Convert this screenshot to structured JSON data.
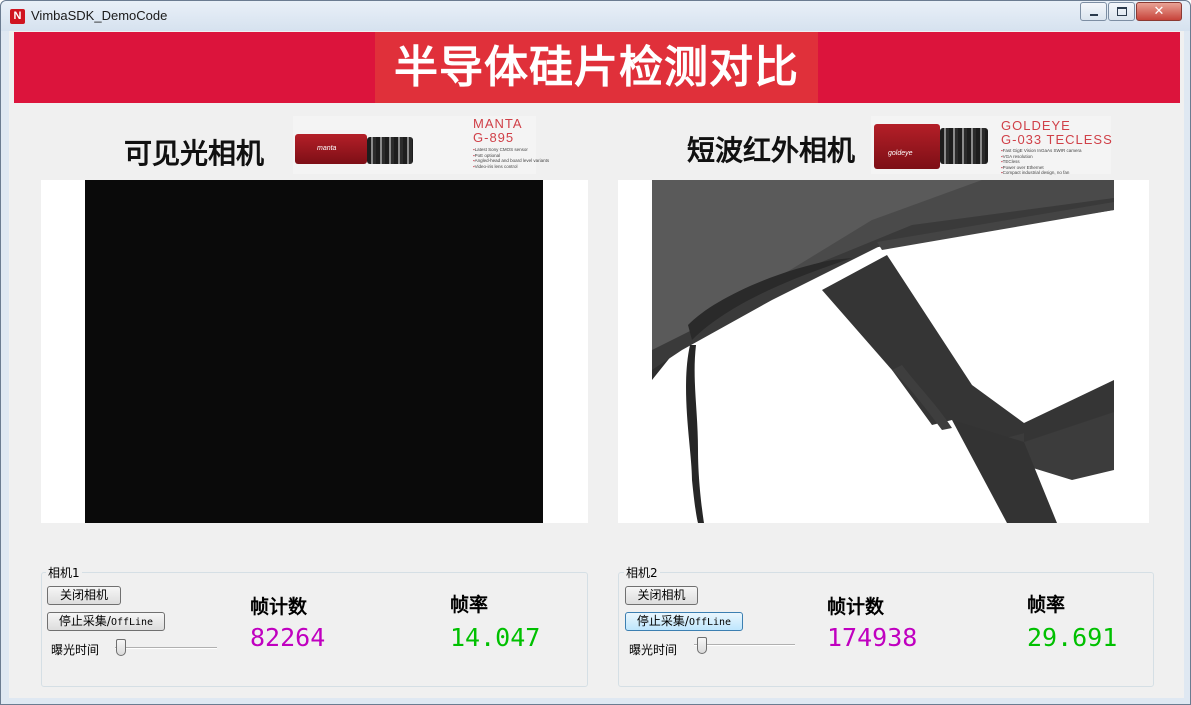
{
  "window": {
    "title": "VimbaSDK_DemoCode",
    "icon": "vimba-logo-icon",
    "close_glyph": "✕"
  },
  "banner": {
    "title": "半导体硅片检测对比",
    "color": "#dc143c"
  },
  "cameras": [
    {
      "heading": "可见光相机",
      "promo": {
        "model_line1": "MANTA",
        "model_line2": "G-895",
        "logo": "manta",
        "bullets": [
          "Latest Sony CMOS sensor",
          "PoE optional",
          "Angled-head and board level variants",
          "Video-iris lens control"
        ]
      },
      "group_label": "相机1",
      "close_button": "关闭相机",
      "stop_button_prefix": "停止采集/",
      "stop_button_mono": "OffLine",
      "exposure_label": "曝光时间",
      "exposure_level": 0.05,
      "frame_count_label": "帧计数",
      "frame_count": "82264",
      "frame_rate_label": "帧率",
      "frame_rate": "14.047"
    },
    {
      "heading": "短波红外相机",
      "promo": {
        "model_line1": "GOLDEYE",
        "model_line2": "G-033 TECLESS",
        "logo": "goldeye",
        "bullets": [
          "Fast GigE Vision InGaAs SWIR camera",
          "VGA resolution",
          "TECless",
          "Power over Ethernet",
          "Compact industrial design, no fan"
        ]
      },
      "group_label": "相机2",
      "close_button": "关闭相机",
      "stop_button_prefix": "停止采集/",
      "stop_button_mono": "OffLine",
      "exposure_label": "曝光时间",
      "exposure_level": 0.05,
      "frame_count_label": "帧计数",
      "frame_count": "174938",
      "frame_rate_label": "帧率",
      "frame_rate": "29.691"
    }
  ],
  "colors": {
    "frame_count": "#c000c0",
    "frame_rate": "#00c000"
  }
}
